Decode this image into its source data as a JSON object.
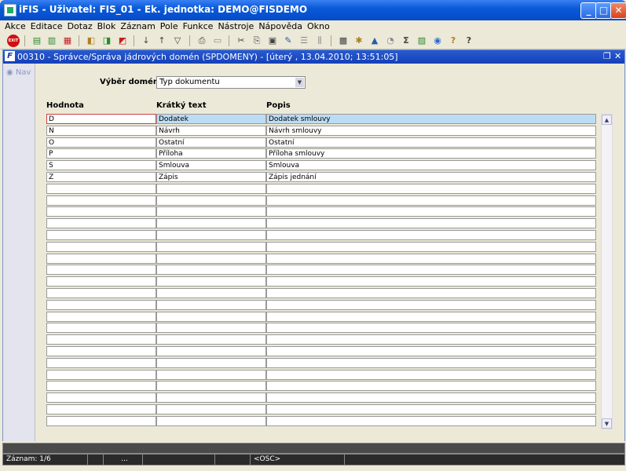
{
  "window": {
    "title": "iFIS - Uživatel: FIS_01 - Ek. jednotka: DEMO@FISDEMO",
    "minimize": "_",
    "maximize": "□",
    "close": "✕"
  },
  "menu": [
    "Akce",
    "Editace",
    "Dotaz",
    "Blok",
    "Záznam",
    "Pole",
    "Funkce",
    "Nástroje",
    "Nápověda",
    "Okno"
  ],
  "toolbar": {
    "exit_label": "EXIT"
  },
  "form": {
    "title": "00310 - Správce/Správa jádrových domén (SPDOMENY) - [úterý , 13.04.2010; 13:51:05]",
    "restore": "❐",
    "close": "✕"
  },
  "nav": {
    "label": "Nav"
  },
  "selector": {
    "label": "Výběr domény",
    "value": "Typ dokumentu",
    "arrow": "▼"
  },
  "table": {
    "headers": [
      "Hodnota",
      "Krátký text",
      "Popis"
    ],
    "rows": [
      [
        "D",
        "Dodatek",
        "Dodatek smlouvy"
      ],
      [
        "N",
        "Návrh",
        "Návrh smlouvy"
      ],
      [
        "O",
        "Ostatní",
        "Ostatní"
      ],
      [
        "P",
        "Příloha",
        "Příloha smlouvy"
      ],
      [
        "S",
        "Smlouva",
        "Smlouva"
      ],
      [
        "Z",
        "Zápis",
        "Zápis jednání"
      ]
    ]
  },
  "scroll": {
    "up": "▲",
    "down": "▼"
  },
  "status": {
    "record": "Záznam: 1/6",
    "dots": "...",
    "osc": "<OSC>"
  }
}
